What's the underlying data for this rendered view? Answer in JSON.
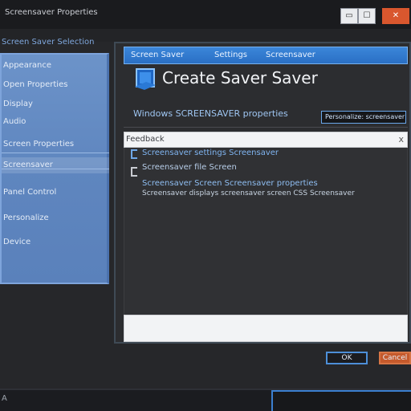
{
  "window": {
    "title": "Screensaver Properties",
    "minimize_glyph": "▭",
    "maximize_glyph": "☐",
    "close_glyph": "✕"
  },
  "sidebar": {
    "header": "Screen Saver Selection",
    "items": [
      {
        "label": "Appearance"
      },
      {
        "label": "Open Properties"
      },
      {
        "label": "Display"
      },
      {
        "label": "Audio"
      },
      {
        "label": "Screen Properties"
      },
      {
        "label": "Screensaver"
      },
      {
        "label": "Panel Control"
      },
      {
        "label": "Personalize"
      },
      {
        "label": "Device"
      }
    ]
  },
  "dialog": {
    "tabs": [
      "Screen Saver",
      "Settings",
      "Screensaver"
    ],
    "title": "Create Saver Saver",
    "subtitle": "Windows SCREENSAVER properties",
    "field_value": "Personalize: screensaver",
    "results": {
      "header": "Feedback",
      "close_glyph": "x",
      "lines": [
        "Screensaver settings Screensaver",
        "Screensaver file Screen",
        "Screensaver Screen Screensaver properties",
        "Screensaver displays screensaver screen CSS Screensaver"
      ]
    }
  },
  "footer": {
    "ok_label": "OK",
    "cancel_label": "Cancel"
  },
  "taskbar": {
    "start_label": "A"
  },
  "colors": {
    "accent": "#3b86d9",
    "sidebar": "#6c93c9",
    "danger": "#d9572e"
  }
}
